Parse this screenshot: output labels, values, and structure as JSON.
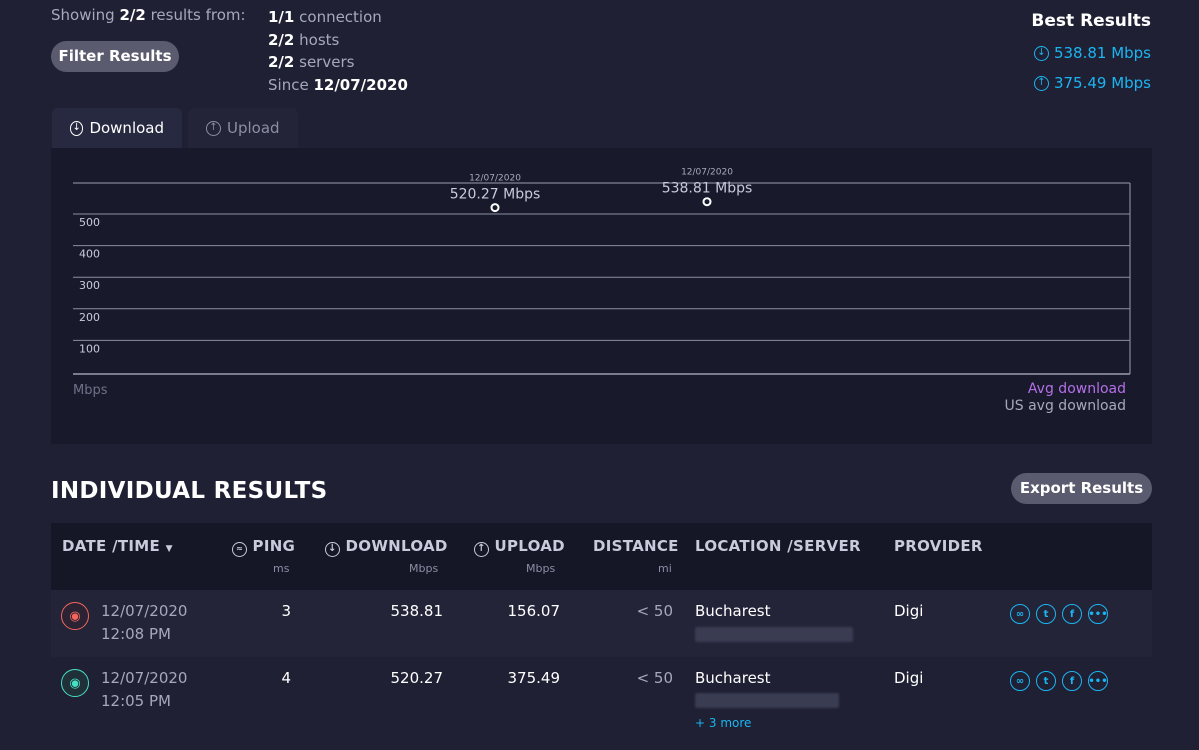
{
  "summary": {
    "showing_prefix": "Showing",
    "showing_count": "2/2",
    "showing_suffix": "results from:",
    "filter_label": "Filter Results",
    "connection_count": "1/1",
    "connection_label": "connection",
    "hosts_count": "2/2",
    "hosts_label": "hosts",
    "servers_count": "2/2",
    "servers_label": "servers",
    "since_label": "Since",
    "since_date": "12/07/2020"
  },
  "best": {
    "title": "Best Results",
    "download": "538.81 Mbps",
    "upload": "375.49 Mbps"
  },
  "tabs": [
    {
      "label": "Download",
      "icon": "download-arrow-icon",
      "active": true
    },
    {
      "label": "Upload",
      "icon": "upload-arrow-icon",
      "active": false
    }
  ],
  "chart_data": {
    "type": "scatter",
    "ylabel": "Mbps",
    "y_ticks": [
      100,
      200,
      300,
      400,
      500
    ],
    "ylim": [
      0,
      600
    ],
    "points": [
      {
        "date": "12/07/2020",
        "label": "520.27 Mbps",
        "value": 520.27
      },
      {
        "date": "12/07/2020",
        "label": "538.81 Mbps",
        "value": 538.81
      }
    ],
    "legend": [
      "Avg download",
      "US avg download"
    ],
    "legend_colors": [
      "#b56fe8",
      "#a7a8bd"
    ]
  },
  "results": {
    "title": "INDIVIDUAL RESULTS",
    "export_label": "Export Results",
    "columns": {
      "datetime": "DATE /TIME",
      "ping": "PING",
      "ping_unit": "ms",
      "download": "DOWNLOAD",
      "download_unit": "Mbps",
      "upload": "UPLOAD",
      "upload_unit": "Mbps",
      "distance": "DISTANCE",
      "distance_unit": "mi",
      "location": "LOCATION /SERVER",
      "provider": "PROVIDER"
    },
    "rows": [
      {
        "date": "12/07/2020",
        "time": "12:08 PM",
        "ping": "3",
        "download": "538.81",
        "upload": "156.07",
        "distance": "< 50",
        "location": "Bucharest",
        "provider": "Digi",
        "more": ""
      },
      {
        "date": "12/07/2020",
        "time": "12:05 PM",
        "ping": "4",
        "download": "520.27",
        "upload": "375.49",
        "distance": "< 50",
        "location": "Bucharest",
        "provider": "Digi",
        "more": "+ 3 more"
      }
    ]
  },
  "colors": {
    "accent": "#1bb5f2",
    "wifi_row1": "#f2665d",
    "wifi_row2": "#47e0c4",
    "avg_download": "#b56fe8"
  }
}
